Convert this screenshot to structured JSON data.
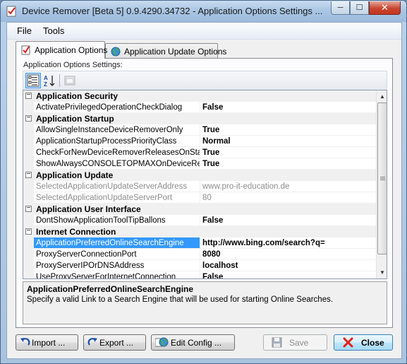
{
  "window": {
    "title": "Device Remover [Beta 5] 0.9.4290.34732 - Application Options Settings ...",
    "caption": {
      "minimize": "─",
      "maximize": "☐",
      "close": "✕"
    }
  },
  "menu": {
    "file": "File",
    "tools": "Tools"
  },
  "tabs": [
    {
      "label": "Application Options",
      "icon": "checklist-icon",
      "active": true
    },
    {
      "label": "Application Update Options",
      "icon": "globe-icon",
      "active": false
    }
  ],
  "options_label": "Application Options Settings:",
  "toolbar": {
    "categorized": "categorized-view-icon",
    "alphabetical": "sort-az-icon",
    "property_pages": "property-pages-icon"
  },
  "grid": {
    "categories": [
      {
        "name": "Application Security",
        "rows": [
          {
            "name": "ActivatePrivilegedOperationCheckDialog",
            "value": "False"
          }
        ]
      },
      {
        "name": "Application Startup",
        "rows": [
          {
            "name": "AllowSingleInstanceDeviceRemoverOnly",
            "value": "True"
          },
          {
            "name": "ApplicationStartupProcessPriorityClass",
            "value": "Normal"
          },
          {
            "name": "CheckForNewDeviceRemoverReleasesOnStartu",
            "value": "True"
          },
          {
            "name": "ShowAlwaysCONSOLETOPMAXOnDeviceRemo",
            "value": "True"
          }
        ]
      },
      {
        "name": "Application Update",
        "rows": [
          {
            "name": "SelectedApplicationUpdateServerAddress",
            "value": "www.pro-it-education.de",
            "readonly": true
          },
          {
            "name": "SelectedApplicationUpdateServerPort",
            "value": "80",
            "readonly": true
          }
        ]
      },
      {
        "name": "Application User Interface",
        "rows": [
          {
            "name": "DontShowApplicationToolTipBallons",
            "value": "False"
          }
        ]
      },
      {
        "name": "Internet Connection",
        "rows": [
          {
            "name": "ApplicationPreferredOnlineSearchEngine",
            "value": "http://www.bing.com/search?q=",
            "selected": true
          },
          {
            "name": "ProxyServerConnectionPort",
            "value": "8080"
          },
          {
            "name": "ProxyServerIPOrDNSAddress",
            "value": "localhost"
          },
          {
            "name": "UseProxyServerForInternetConnection",
            "value": "False"
          }
        ]
      }
    ],
    "scroll_position": 0.0
  },
  "help": {
    "title": "ApplicationPreferredOnlineSearchEngine",
    "description": "Specify a valid Link to a Search Engine that will be used for starting Online Searches."
  },
  "buttons": {
    "import": "Import ...",
    "export": "Export ...",
    "edit_config": "Edit Config ...",
    "save": "Save",
    "close": "Close"
  },
  "colors": {
    "selection": "#3399ff",
    "close_icon": "#e0201a",
    "accent": "#3c7fb1"
  }
}
